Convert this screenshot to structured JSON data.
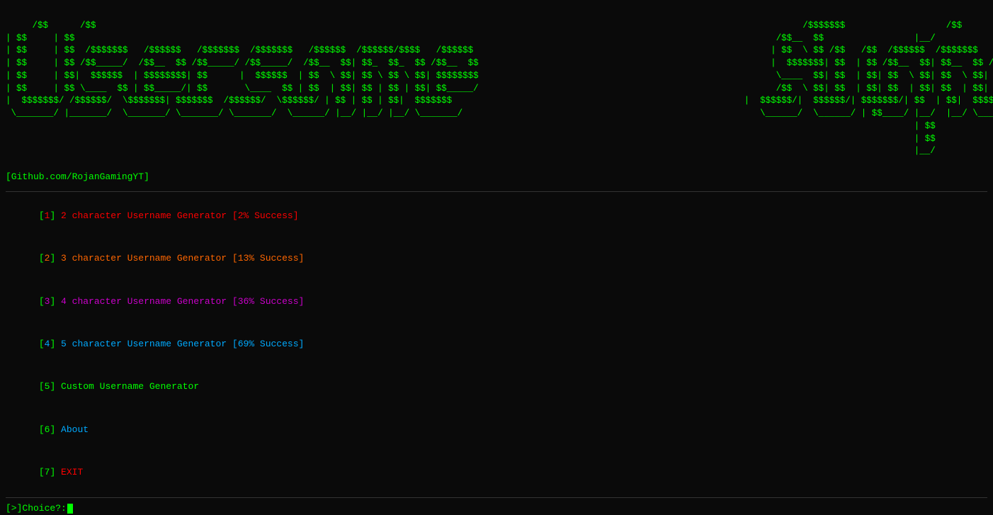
{
  "ascii": {
    "line1": " /$$      /$$                                                                                                                                     /$$$$$$$                   /$$  ",
    "line2": "| $$     | $$                                                                                                                                    /$$__  $$                 |__/  ",
    "line3": "| $$     | $$  /$$$$$$$   /$$$$$$   /$$$$$$$  /$$$$$$$   /$$$$$$  /$$$$$$/$$$$   /$$$$$$                                                       | $$  \\ $$ /$$   /$$  /$$$$$$  /$$$$$$$   /$$$$$$   /$$$$$$  /$$$$$$$  ",
    "line4": "| $$     | $$ /$$_____/  /$$__  $$ /$$_____/ /$$_____/  /$$__  $$| $$_  $$_  $$ /$$__  $$                                                      |  $$$$$$$| $$  | $$ /$$__  $$| $$__  $$ /$$__  $$ /$$__  $$| $$__  $$ ",
    "line5": "| $$     | $$|  $$$$$$  | $$$$$$$$| $$      |  $$$$$$  | $$  \\ $$| $$ \\ $$ \\ $$| $$$$$$$$                                                       \\____  $$| $$  | $$| $$  \\ $$| $$  \\ $$| $$$$$$$$| $$  \\__/| $$  \\ $$ ",
    "line6": "| $$     | $$ \\____  $$ | $$_____/| $$       \\____  $$ | $$  | $$| $$ | $$ | $$| $$_____/                                                       /$$  \\ $$| $$  | $$| $$  | $$| $$  | $$| $$_____/| $$      | $$  | $$ ",
    "line7": "|  $$$$$$$/ /$$$$$$$/|  $$$$$$$| $$$$$$$  /$$$$$$$/ |  $$$$$$/| $$ | $$ | $$|  $$$$$$$                                                      |  $$$$$$/|  $$$$$$/| $$$$$$$/| $$  | $$|  $$$$$$$| $$      | $$  | $$ ",
    "line8": " \\_______/ |_______/  \\_______/ \\_______/ \\_______/   \\______/ |__/ |__/ |__/ \\_______/                                                       \\______/  \\______/ | $$____/ |__/  |__/ \\_______/|__/      |__/  |__/ ",
    "line9": "                                                                                                                                                                           | $$                                          ",
    "line10": "                                                                                                                                                                          | $$                                          ",
    "line11": "                                                                                                                                                                          |__/                                          ",
    "github": "[Github.com/RojanGamingYT]"
  },
  "menu": {
    "items": [
      {
        "num": "1",
        "label": "2 character Username Generator",
        "success": "[2% Success]"
      },
      {
        "num": "2",
        "label": "3 character Username Generator",
        "success": "[13% Success]"
      },
      {
        "num": "3",
        "label": "4 character Username Generator",
        "success": "[36% Success]"
      },
      {
        "num": "4",
        "label": "5 character Username Generator",
        "success": "[69% Success]"
      },
      {
        "num": "5",
        "label": "Custom Username Generator",
        "success": ""
      },
      {
        "num": "6",
        "label": "About",
        "success": ""
      },
      {
        "num": "7",
        "label": "EXIT",
        "success": ""
      }
    ]
  },
  "prompt": {
    "prefix": "[>]",
    "label": " Choice?: "
  }
}
